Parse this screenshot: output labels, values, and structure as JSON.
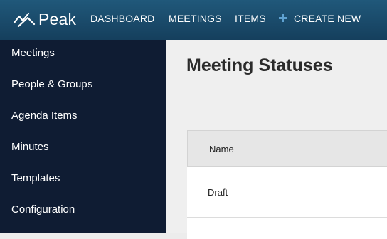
{
  "header": {
    "logo_text": "Peak",
    "nav": {
      "dashboard": "DASHBOARD",
      "meetings": "MEETINGS",
      "items": "ITEMS",
      "create_new": "CREATE NEW"
    }
  },
  "sidebar": {
    "items": [
      {
        "label": "Meetings"
      },
      {
        "label": "People & Groups"
      },
      {
        "label": "Agenda Items"
      },
      {
        "label": "Minutes"
      },
      {
        "label": "Templates"
      },
      {
        "label": "Configuration"
      }
    ]
  },
  "main": {
    "title": "Meeting Statuses",
    "table": {
      "columns": [
        "Name"
      ],
      "rows": [
        {
          "name": "Draft"
        }
      ]
    }
  },
  "colors": {
    "header_bg": "#1b4b6c",
    "sidebar_bg": "#0f1c33",
    "accent_plus": "#5ea1d0",
    "content_bg": "#efefef"
  },
  "icons": {
    "logo": "peak-logo-icon",
    "create": "plus-icon"
  }
}
